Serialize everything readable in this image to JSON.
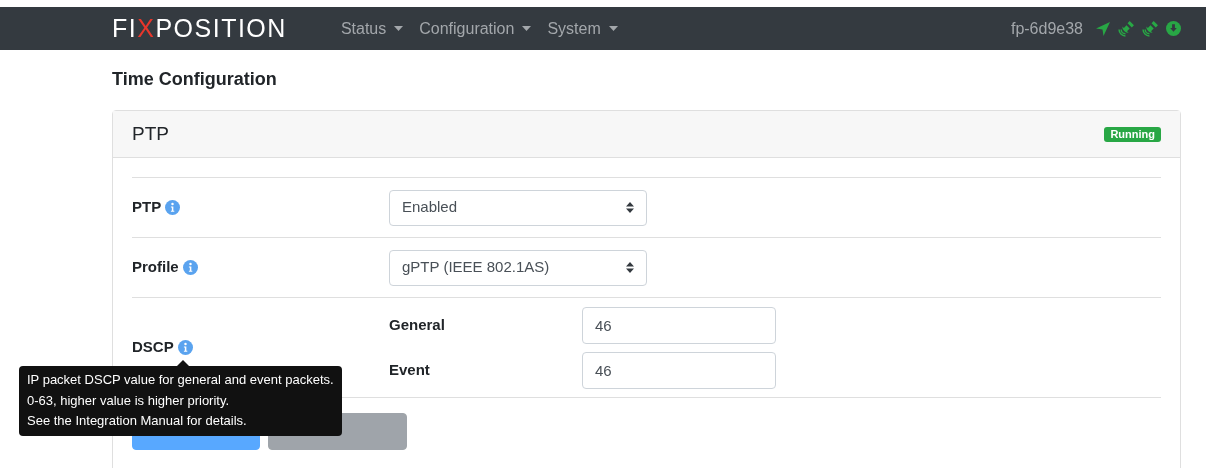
{
  "navbar": {
    "logo": {
      "before": "FI",
      "accent": "X",
      "after": "POSITION"
    },
    "menus": [
      {
        "label": "Status"
      },
      {
        "label": "Configuration"
      },
      {
        "label": "System"
      }
    ],
    "device": "fp-6d9e38"
  },
  "page_title": "Time Configuration",
  "card": {
    "title": "PTP",
    "status": "Running",
    "rows": [
      {
        "kind": "select",
        "label": "PTP",
        "value": "Enabled"
      },
      {
        "kind": "select",
        "label": "Profile",
        "value": "gPTP (IEEE 802.1AS)"
      },
      {
        "kind": "inputs",
        "label": "DSCP",
        "fields": [
          {
            "label": "General",
            "value": "46"
          },
          {
            "label": "Event",
            "value": "46"
          }
        ]
      }
    ],
    "buttons": [
      {
        "kind": "primary",
        "disabled": true
      },
      {
        "kind": "secondary",
        "disabled": true
      }
    ]
  },
  "tooltip": {
    "lines": [
      "IP packet DSCP value for general and event packets.",
      "0-63, higher value is higher priority.",
      "See the Integration Manual for details."
    ]
  }
}
